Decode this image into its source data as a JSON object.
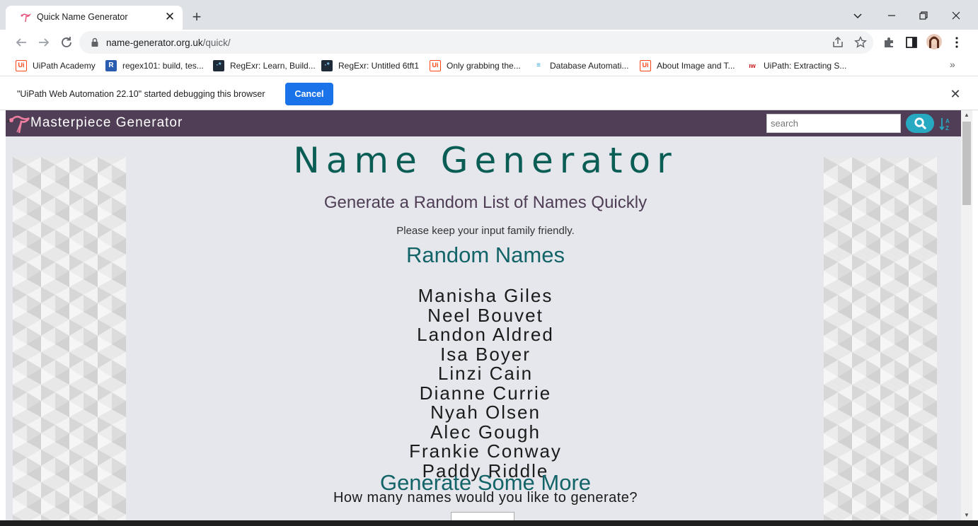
{
  "browser": {
    "tab_title": "Quick Name Generator",
    "new_tab_symbol": "+",
    "close_symbol": "✕",
    "url_host": "name-generator.org.uk",
    "url_path": "/quick/"
  },
  "bookmarks": [
    {
      "label": "UiPath Academy",
      "icon": "Ui",
      "color": "#fa4616"
    },
    {
      "label": "regex101: build, tes...",
      "icon": "R",
      "color": "#2a5db0"
    },
    {
      "label": "RegExr: Learn, Build...",
      "icon": "·*",
      "color": "#1e2a38"
    },
    {
      "label": "RegExr: Untitled 6tft1",
      "icon": "·*",
      "color": "#1e2a38"
    },
    {
      "label": "Only grabbing the...",
      "icon": "Ui",
      "color": "#fa4616"
    },
    {
      "label": "Database Automati...",
      "icon": "≡",
      "color": "#2aa4d8"
    },
    {
      "label": "About Image and T...",
      "icon": "Ui",
      "color": "#fa4616"
    },
    {
      "label": "UiPath: Extracting S...",
      "icon": "ıw",
      "color": "#c7161b"
    }
  ],
  "bookmarks_overflow": "»",
  "infobar": {
    "message": "\"UiPath Web Automation 22.10\" started debugging this browser",
    "cancel_label": "Cancel"
  },
  "site": {
    "brand": "Masterpiece Generator",
    "search_placeholder": "search",
    "title": "Name Generator",
    "subtitle": "Generate a Random List of Names Quickly",
    "note": "Please keep your input family friendly.",
    "random_heading": "Random Names",
    "names": [
      "Manisha Giles",
      "Neel Bouvet",
      "Landon Aldred",
      "Isa Boyer",
      "Linzi Cain",
      "Dianne Currie",
      "Nyah Olsen",
      "Alec Gough",
      "Frankie Conway",
      "Paddy Riddle"
    ],
    "more_heading": "Generate Some More",
    "question": "How many names would you like to generate?"
  },
  "colors": {
    "nav_bg": "#4f3e55",
    "title_teal": "#0a5d55",
    "search_button": "#27a9c2",
    "cancel_blue": "#1a73e8"
  }
}
